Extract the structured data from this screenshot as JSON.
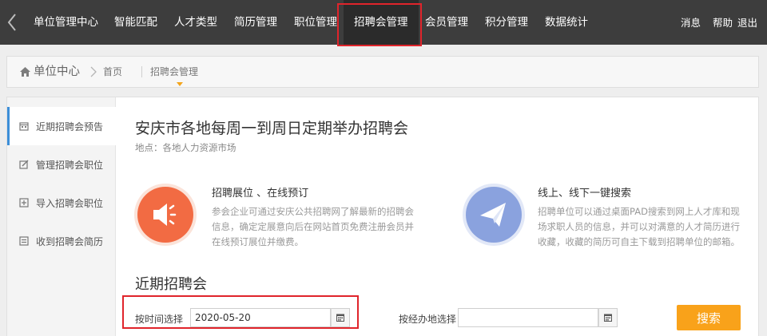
{
  "topnav": {
    "back_icon": "chevron-left-icon",
    "items": [
      {
        "label": "单位管理中心"
      },
      {
        "label": "智能匹配"
      },
      {
        "label": "人才类型"
      },
      {
        "label": "简历管理"
      },
      {
        "label": "职位管理"
      },
      {
        "label": "招聘会管理",
        "active": true
      },
      {
        "label": "会员管理"
      },
      {
        "label": "积分管理"
      },
      {
        "label": "数据统计"
      }
    ],
    "right": [
      {
        "label": "消息"
      },
      {
        "label": "帮助"
      },
      {
        "label": "退出"
      }
    ]
  },
  "breadcrumb": {
    "home_label": "单位中心",
    "home_icon": "home-icon",
    "items": [
      {
        "label": "首页"
      },
      {
        "label": "招聘会管理"
      }
    ],
    "active_color": "#f3a51c"
  },
  "sidebar": {
    "items": [
      {
        "label": "近期招聘会预告",
        "icon": "calendar-icon",
        "active": true
      },
      {
        "label": "管理招聘会职位",
        "icon": "edit-icon"
      },
      {
        "label": "导入招聘会职位",
        "icon": "import-icon"
      },
      {
        "label": "收到招聘会简历",
        "icon": "document-icon"
      }
    ],
    "accent_color": "#3d8fd8"
  },
  "main": {
    "title": "安庆市各地每周一到周日定期举办招聘会",
    "location": "地点：各地人力资源市场",
    "features": [
      {
        "icon": "megaphone-icon",
        "title": "招聘展位 、在线预订",
        "desc": "参会企业可通过安庆公共招聘网了解最新的招聘会信息，确定定展意向后在网站首页免费注册会员并在线预订展位并缴费。",
        "color": "#f26b43"
      },
      {
        "icon": "paper-plane-icon",
        "title": "线上、线下一键搜索",
        "desc": "招聘单位可以通过桌面PAD搜索到网上人才库和现场求职人员的信息，并可以对满意的人才简历进行收藏，收藏的简历可自主下载到招聘单位的邮箱。",
        "color": "#8aa2de"
      }
    ],
    "section_title": "近期招聘会",
    "filters": {
      "time_label": "按时间选择",
      "time_value": "2020-05-20",
      "place_label": "按经办地选择",
      "place_value": "",
      "calendar_icon": "calendar-icon"
    },
    "search_label": "搜索",
    "search_color": "#f9a21a"
  },
  "highlight_color": "#e0242b"
}
